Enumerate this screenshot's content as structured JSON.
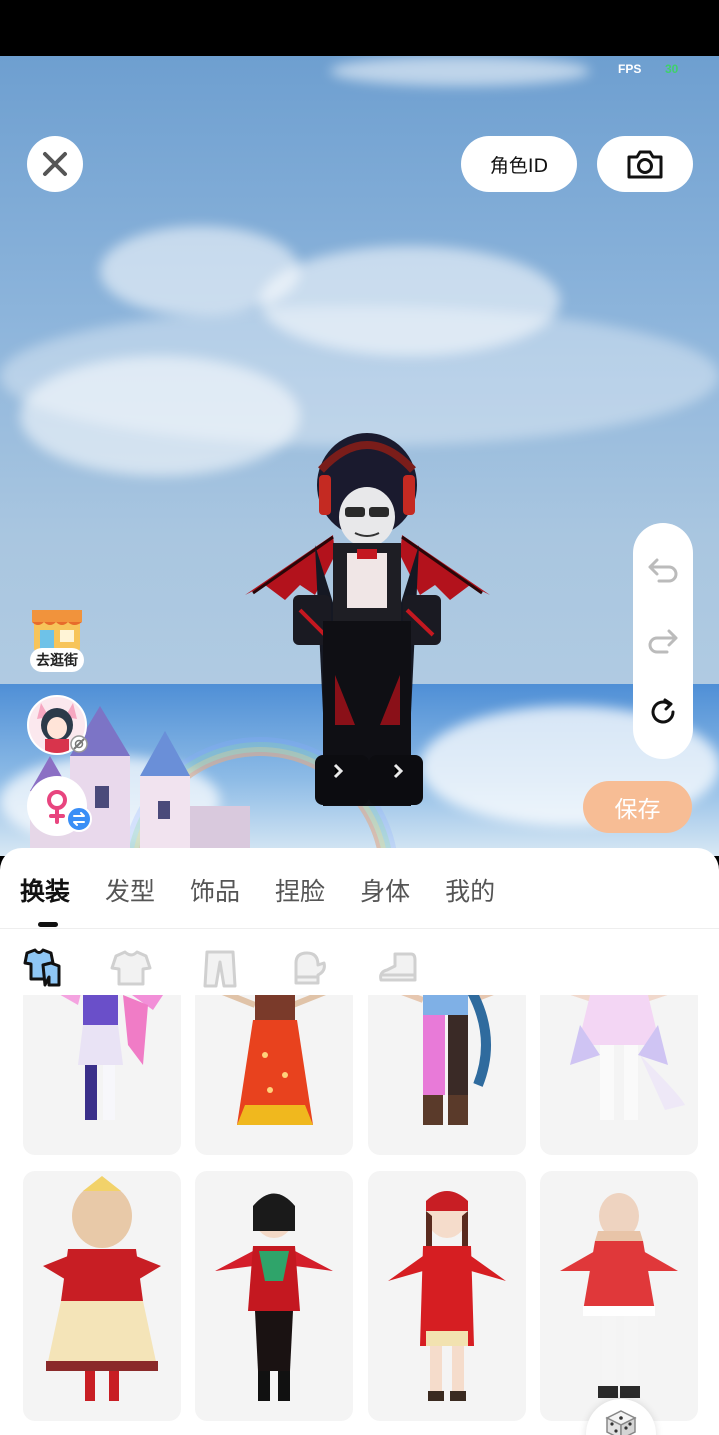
{
  "status": {
    "fps_label": "FPS",
    "fps_value": "30"
  },
  "header": {
    "role_id_label": "角色ID"
  },
  "side": {
    "shop_label": "去逛街"
  },
  "save_label": "保存",
  "tabs": [
    {
      "label": "换装",
      "active": true
    },
    {
      "label": "发型",
      "active": false
    },
    {
      "label": "饰品",
      "active": false
    },
    {
      "label": "捏脸",
      "active": false
    },
    {
      "label": "身体",
      "active": false
    },
    {
      "label": "我的",
      "active": false
    }
  ],
  "sub_icons": [
    "outfit-set-icon",
    "top-icon",
    "pants-icon",
    "gloves-icon",
    "shoes-icon"
  ],
  "colors": {
    "save_button": "#f7bd95",
    "swap_badge": "#3a8ef6",
    "fps_value": "#3fd16b",
    "gender": "#e8457f"
  }
}
